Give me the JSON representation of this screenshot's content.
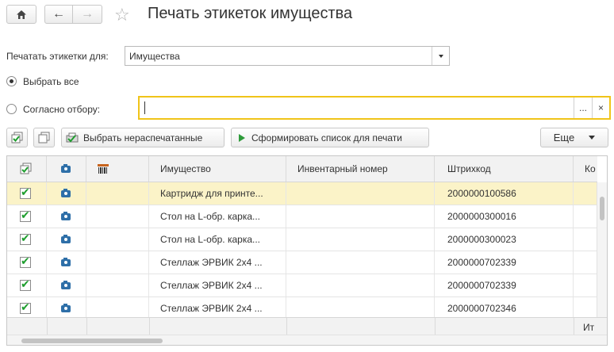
{
  "window": {
    "title": "Печать этикеток имущества"
  },
  "form": {
    "print_for_label": "Печатать этикетки для:",
    "print_for_value": "Имущества",
    "select_all_label": "Выбрать все",
    "by_filter_label": "Согласно отбору:",
    "filter_value": "",
    "filter_choose_glyph": "...",
    "filter_clear_glyph": "×"
  },
  "toolbar": {
    "select_unprinted_label": "Выбрать нераспечатанные",
    "generate_list_label": "Сформировать список для печати",
    "more_label": "Еще"
  },
  "table": {
    "columns": [
      "Имущество",
      "Инвентарный номер",
      "Штрихкод",
      "Ко"
    ],
    "rows": [
      {
        "checked": true,
        "name": "Картридж для принте...",
        "inv": "",
        "barcode": "2000000100586",
        "selected": true
      },
      {
        "checked": true,
        "name": "Стол на L-обр. карка...",
        "inv": "",
        "barcode": "2000000300016",
        "selected": false
      },
      {
        "checked": true,
        "name": "Стол на L-обр. карка...",
        "inv": "",
        "barcode": "2000000300023",
        "selected": false
      },
      {
        "checked": true,
        "name": "Стеллаж ЭРВИК 2x4 ...",
        "inv": "",
        "barcode": "2000000702339",
        "selected": false
      },
      {
        "checked": true,
        "name": "Стеллаж ЭРВИК 2x4 ...",
        "inv": "",
        "barcode": "2000000702339",
        "selected": false
      },
      {
        "checked": true,
        "name": "Стеллаж ЭРВИК 2x4 ...",
        "inv": "",
        "barcode": "2000000702346",
        "selected": false
      }
    ],
    "footer_total": "Ит"
  },
  "colors": {
    "accent_yellow": "#f0c419",
    "selected_row": "#fbf3c8",
    "check_green": "#1e9e2e"
  }
}
